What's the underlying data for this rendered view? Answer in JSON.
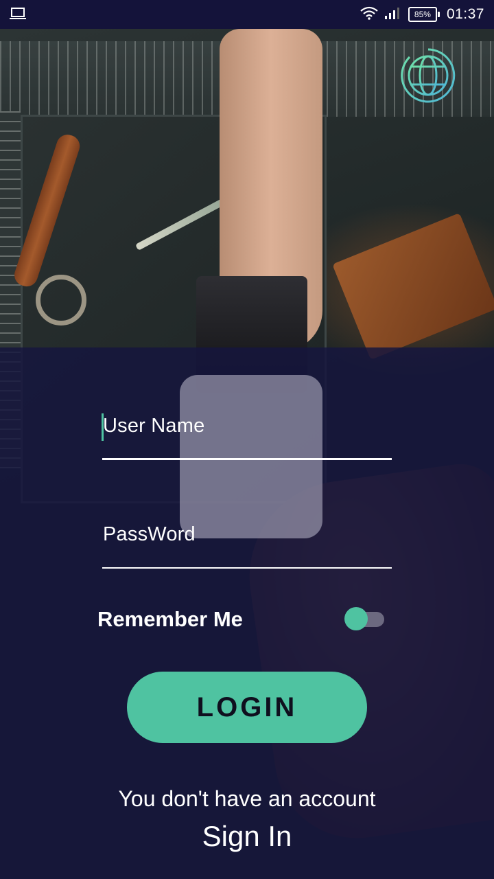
{
  "status_bar": {
    "battery_percent": "85%",
    "time": "01:37",
    "left_icon": "laptop-icon",
    "right_icons": [
      "wifi-icon",
      "signal-icon",
      "battery-icon"
    ]
  },
  "header": {
    "language_icon": "globe-icon"
  },
  "login_form": {
    "username_placeholder": "User Name",
    "password_placeholder": "PassWord",
    "remember_label": "Remember Me",
    "remember_on": true,
    "login_label": "LOGIN"
  },
  "footer": {
    "no_account_text": "You don't have an account",
    "signin_label": "Sign In"
  },
  "colors": {
    "accent": "#4fc3a1",
    "overlay": "#16153e",
    "status_bar": "#14133a",
    "text": "#ffffff"
  }
}
